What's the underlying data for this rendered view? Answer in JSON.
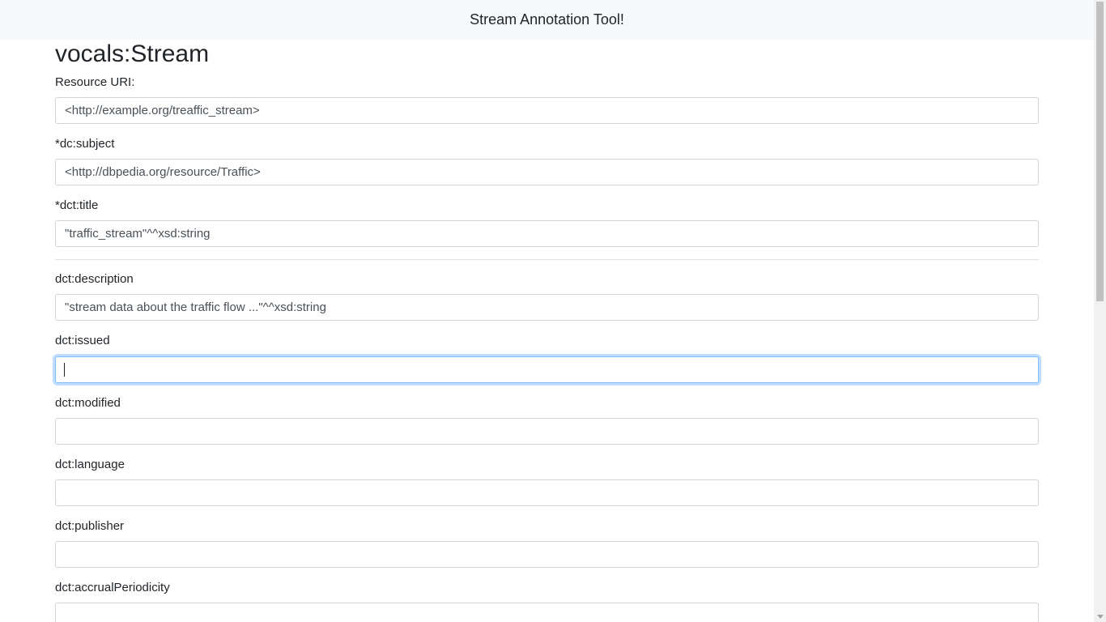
{
  "header": {
    "title": "Stream Annotation Tool!"
  },
  "page": {
    "title": "vocals:Stream"
  },
  "fields": [
    {
      "label": "Resource URI:",
      "value": "<http://example.org/treaffic_stream>"
    },
    {
      "label": "*dc:subject",
      "value": "<http://dbpedia.org/resource/Traffic>"
    },
    {
      "label": "*dct:title",
      "value": "\"traffic_stream\"^^xsd:string"
    },
    {
      "label": "dct:description",
      "value": "\"stream data about the traffic flow ...\"^^xsd:string"
    },
    {
      "label": "dct:issued",
      "value": ""
    },
    {
      "label": "dct:modified",
      "value": ""
    },
    {
      "label": "dct:language",
      "value": ""
    },
    {
      "label": "dct:publisher",
      "value": ""
    },
    {
      "label": "dct:accrualPeriodicity",
      "value": ""
    }
  ]
}
